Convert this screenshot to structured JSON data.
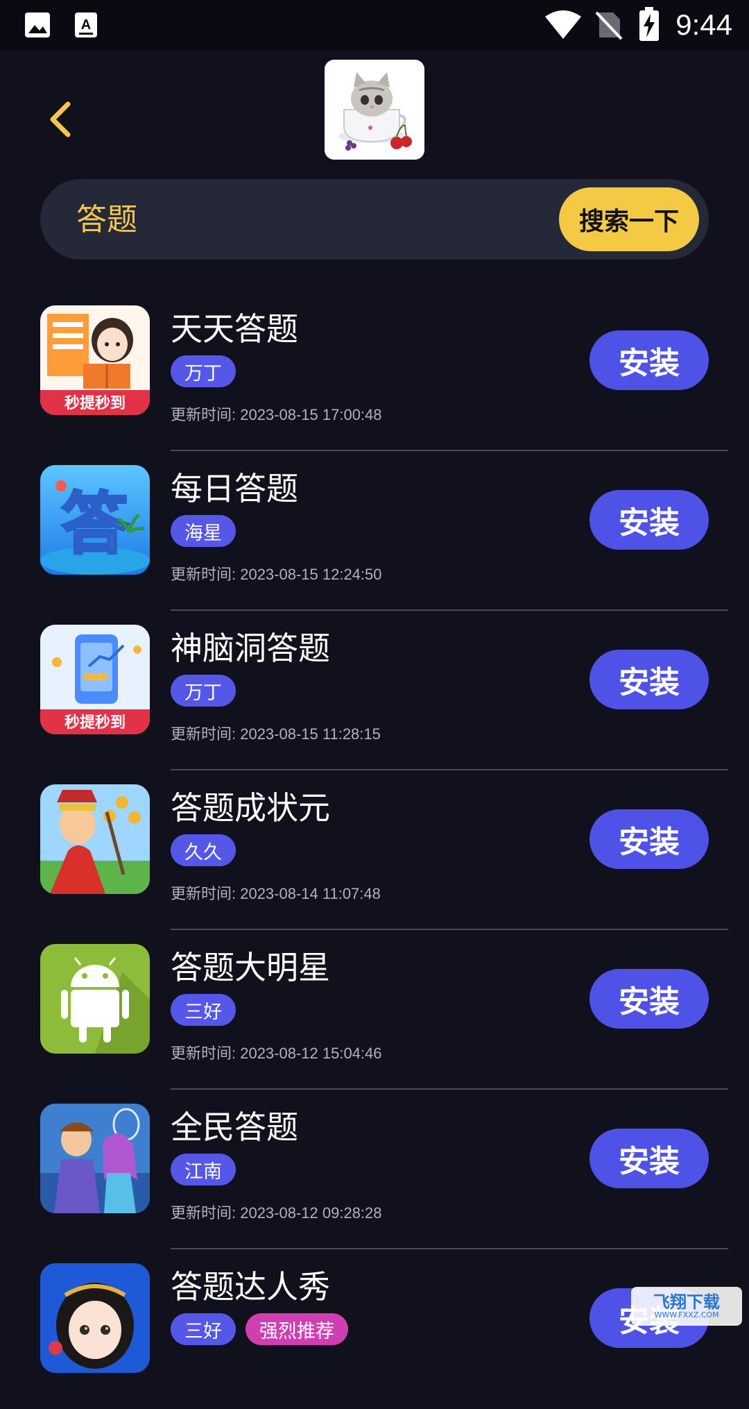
{
  "status_bar": {
    "time": "9:44"
  },
  "search": {
    "query": "答题",
    "button_label": "搜索一下"
  },
  "apps": [
    {
      "name": "天天答题",
      "tags": [
        "万丁"
      ],
      "update_time": "更新时间: 2023-08-15 17:00:48",
      "install_label": "安装",
      "icon_text": "秒提秒到"
    },
    {
      "name": "每日答题",
      "tags": [
        "海星"
      ],
      "update_time": "更新时间: 2023-08-15 12:24:50",
      "install_label": "安装",
      "icon_text": "答"
    },
    {
      "name": "神脑洞答题",
      "tags": [
        "万丁"
      ],
      "update_time": "更新时间: 2023-08-15 11:28:15",
      "install_label": "安装",
      "icon_text": "秒提秒到"
    },
    {
      "name": "答题成状元",
      "tags": [
        "久久"
      ],
      "update_time": "更新时间: 2023-08-14 11:07:48",
      "install_label": "安装"
    },
    {
      "name": "答题大明星",
      "tags": [
        "三好"
      ],
      "update_time": "更新时间: 2023-08-12 15:04:46",
      "install_label": "安装"
    },
    {
      "name": "全民答题",
      "tags": [
        "江南"
      ],
      "update_time": "更新时间: 2023-08-12 09:28:28",
      "install_label": "安装"
    },
    {
      "name": "答题达人秀",
      "tags": [
        "三好",
        "强烈推荐"
      ],
      "update_time": "",
      "install_label": "安装"
    }
  ],
  "watermark": {
    "text": "飞翔下载",
    "sub": "WWW.FXXZ.COM"
  }
}
